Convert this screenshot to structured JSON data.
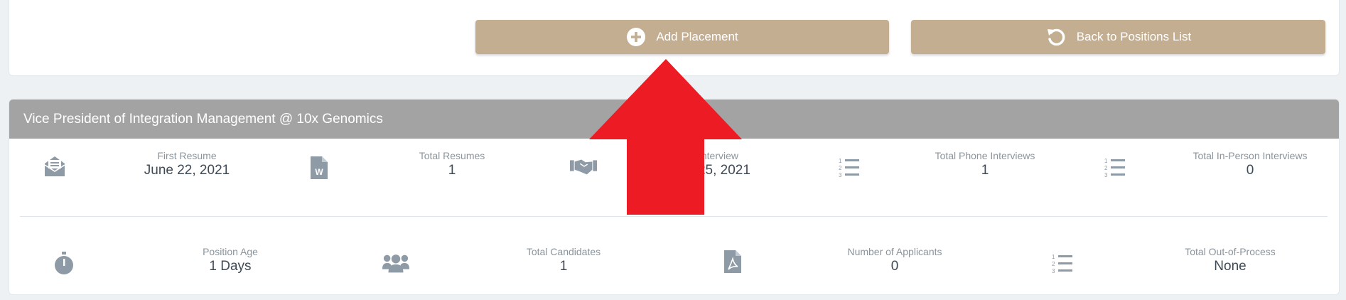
{
  "toolbar": {
    "add_placement_label": "Add Placement",
    "back_label": "Back to Positions List"
  },
  "position": {
    "title": "Vice President of Integration Management @ 10x Genomics"
  },
  "stats_row1": [
    {
      "icon": "envelope-open-icon",
      "label": "First Resume",
      "value": "June 22, 2021"
    },
    {
      "icon": "word-file-icon",
      "label": "Total Resumes",
      "value": "1"
    },
    {
      "icon": "handshake-icon",
      "label": "Interview",
      "value": "e 25, 2021"
    },
    {
      "icon": "numbered-list-icon",
      "label": "Total Phone Interviews",
      "value": "1"
    },
    {
      "icon": "numbered-list-icon",
      "label": "Total In-Person Interviews",
      "value": "0"
    }
  ],
  "stats_row2": [
    {
      "icon": "stopwatch-icon",
      "label": "Position Age",
      "value": "1 Days"
    },
    {
      "icon": "users-icon",
      "label": "Total Candidates",
      "value": "1"
    },
    {
      "icon": "pdf-file-icon",
      "label": "Number of Applicants",
      "value": "0"
    },
    {
      "icon": "numbered-list-icon",
      "label": "Total Out-of-Process",
      "value": "None"
    }
  ],
  "colors": {
    "button": "#c4ae91",
    "header": "#a3a3a3",
    "icon": "#8e9aa6",
    "arrow": "#ed1c24"
  }
}
